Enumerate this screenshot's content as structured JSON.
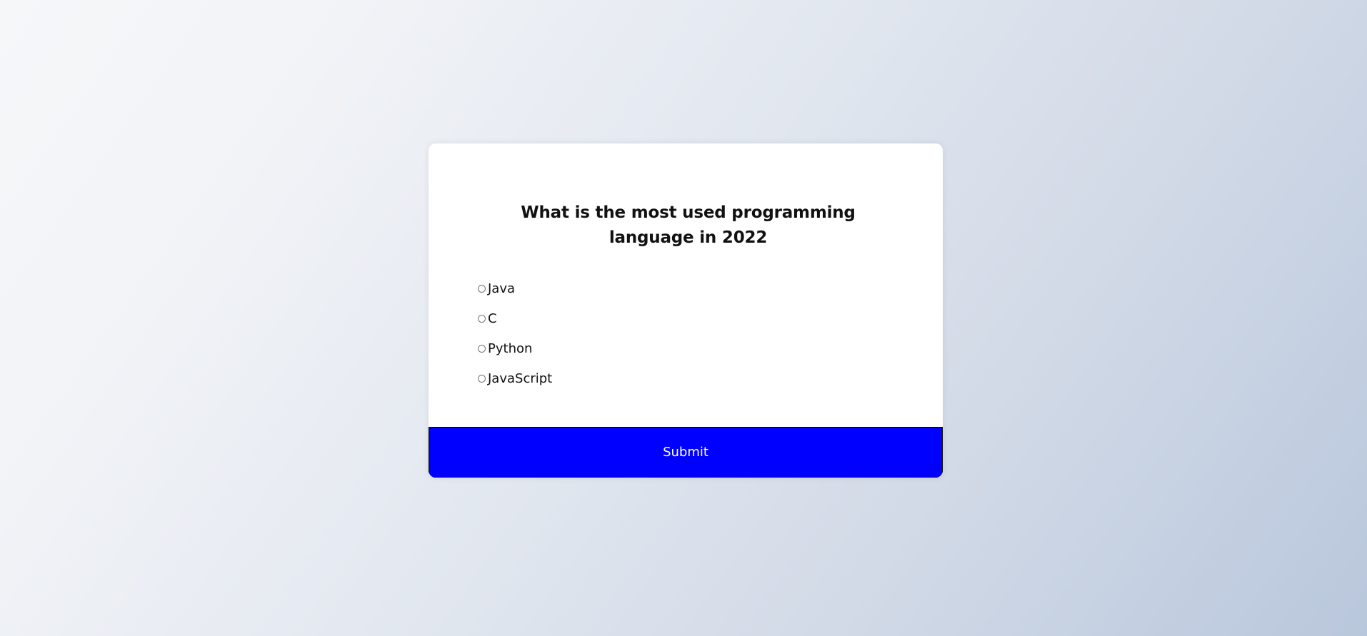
{
  "quiz": {
    "question": "What is the most used programming language in 2022",
    "answers": [
      {
        "label": "Java",
        "selected": false
      },
      {
        "label": "C",
        "selected": false
      },
      {
        "label": "Python",
        "selected": false
      },
      {
        "label": "JavaScript",
        "selected": false
      }
    ],
    "submit_label": "Submit"
  },
  "colors": {
    "submit_bg": "#0000ff",
    "card_bg": "#ffffff",
    "text": "#111111"
  }
}
